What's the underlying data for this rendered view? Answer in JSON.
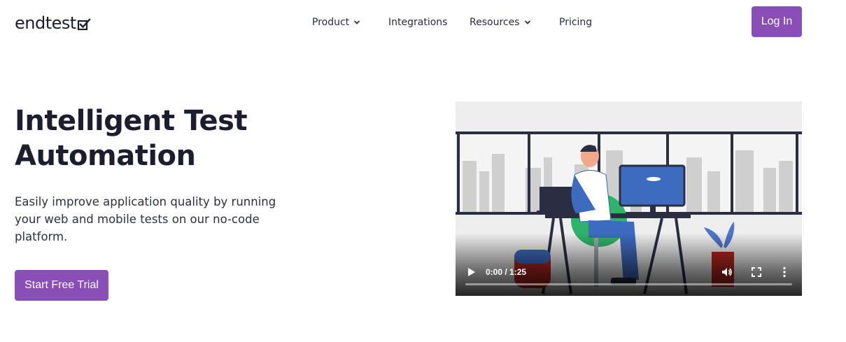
{
  "brand": {
    "name": "endtest",
    "accent": "#8a4fb6"
  },
  "nav": {
    "items": [
      {
        "label": "Product",
        "has_dropdown": true
      },
      {
        "label": "Integrations",
        "has_dropdown": false
      },
      {
        "label": "Resources",
        "has_dropdown": true
      },
      {
        "label": "Pricing",
        "has_dropdown": false
      }
    ],
    "login_label": "Log In"
  },
  "hero": {
    "title": "Intelligent Test Automation",
    "subtitle": "Easily improve application quality by running your web and mobile tests on our no-code platform.",
    "cta_label": "Start Free Trial"
  },
  "video": {
    "time": "0:00 / 1:25",
    "progress": 0,
    "icons": [
      "play-icon",
      "volume-icon",
      "fullscreen-icon",
      "more-options-icon"
    ]
  }
}
